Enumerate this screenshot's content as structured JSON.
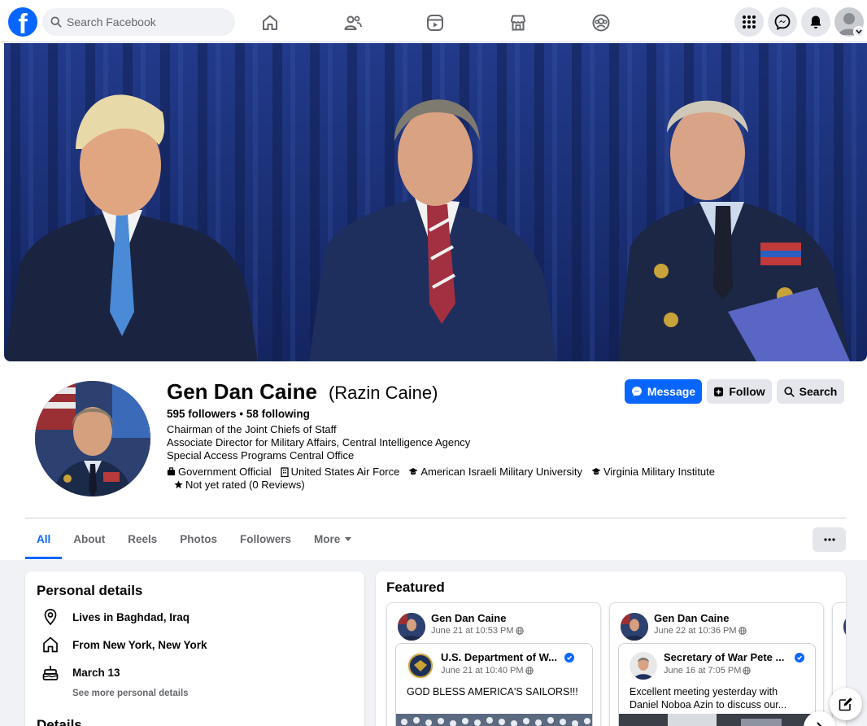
{
  "topbar": {
    "logo": "f",
    "search_placeholder": "Search Facebook",
    "nav_icons": [
      "home-icon",
      "friends-icon",
      "video-icon",
      "marketplace-icon",
      "groups-icon"
    ],
    "right_icons": [
      "menu-grid-icon",
      "messenger-icon",
      "notifications-icon",
      "account-avatar"
    ]
  },
  "profile": {
    "name": "Gen Dan Caine",
    "alternate_name": "(Razin Caine)",
    "followers": "595 followers",
    "separator": "•",
    "following": "58 following",
    "bio": [
      "Chairman of the Joint Chiefs of Staff",
      "Associate Director for Military Affairs, Central Intelligence Agency",
      "Special Access Programs Central Office"
    ],
    "chips": [
      {
        "icon": "briefcase-icon",
        "label": "Government Official"
      },
      {
        "icon": "building-icon",
        "label": "United States Air Force"
      },
      {
        "icon": "graduation-cap-icon",
        "label": "American Israeli Military University"
      },
      {
        "icon": "graduation-cap-icon",
        "label": "Virginia Military Institute"
      }
    ],
    "rating": "Not yet rated (0 Reviews)"
  },
  "actions": {
    "message": "Message",
    "follow": "Follow",
    "search": "Search"
  },
  "tabs": [
    {
      "label": "All",
      "active": true
    },
    {
      "label": "About"
    },
    {
      "label": "Reels"
    },
    {
      "label": "Photos"
    },
    {
      "label": "Followers"
    },
    {
      "label": "More"
    }
  ],
  "personal_details": {
    "title": "Personal details",
    "rows": [
      {
        "icon": "location-pin-icon",
        "text": "Lives in Baghdad, Iraq"
      },
      {
        "icon": "home-icon",
        "text": "From New York, New York"
      },
      {
        "icon": "birthday-cake-icon",
        "text": "March 13"
      }
    ],
    "see_more": "See more personal details",
    "details_heading": "Details"
  },
  "featured": {
    "title": "Featured",
    "cards": [
      {
        "author": "Gen Dan Caine",
        "date": "June 21 at 10:53 PM",
        "shared_author": "U.S. Department of W...",
        "shared_date": "June 21 at 10:40 PM",
        "text": "GOD BLESS AMERICA'S SAILORS!!!"
      },
      {
        "author": "Gen Dan Caine",
        "date": "June 22 at 10:36 PM",
        "shared_author": "Secretary of War Pete ...",
        "shared_date": "June 16 at 7:05 PM",
        "text": "Excellent meeting yesterday with Daniel Noboa Azin to discuss our..."
      }
    ]
  },
  "colors": {
    "brand_blue": "#0866ff",
    "secondary_text": "#65676b",
    "page_background": "#f0f2f5"
  }
}
